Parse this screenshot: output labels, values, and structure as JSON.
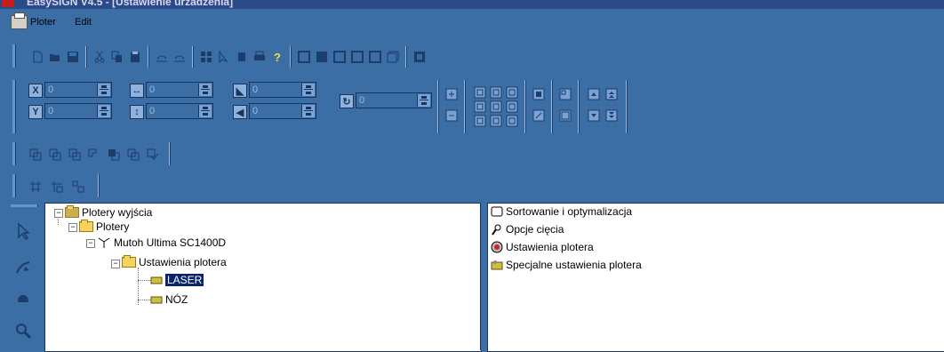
{
  "window": {
    "title": "EasySIGN V4.5 - [Ustawienie urzadzenia]"
  },
  "menu": {
    "items": [
      {
        "label": "Ploter"
      },
      {
        "label": "Edit"
      }
    ]
  },
  "coords": {
    "x_label": "X",
    "y_label": "Y",
    "x_value": "0",
    "y_value": "0",
    "width_value": "0",
    "height_value": "0",
    "sx_value": "0",
    "sy_value": "0",
    "rot_value": "0"
  },
  "tree": {
    "root": "Plotery wyjścia",
    "plotery": "Plotery",
    "device": "Mutoh Ultima SC1400D",
    "settings": "Ustawienia plotera",
    "laser": "LASER",
    "noz": "NÓZ"
  },
  "right_list": [
    {
      "label": "Sortowanie i optymalizacja",
      "icon": "sort-icon"
    },
    {
      "label": "Opcje cięcia",
      "icon": "cut-icon"
    },
    {
      "label": "Ustawienia plotera",
      "icon": "settings-icon"
    },
    {
      "label": "Specjalne ustawienia plotera",
      "icon": "special-settings-icon"
    }
  ],
  "colors": {
    "background": "#3a6ea5",
    "selection": "#0a246a",
    "panel": "#ffffff"
  }
}
